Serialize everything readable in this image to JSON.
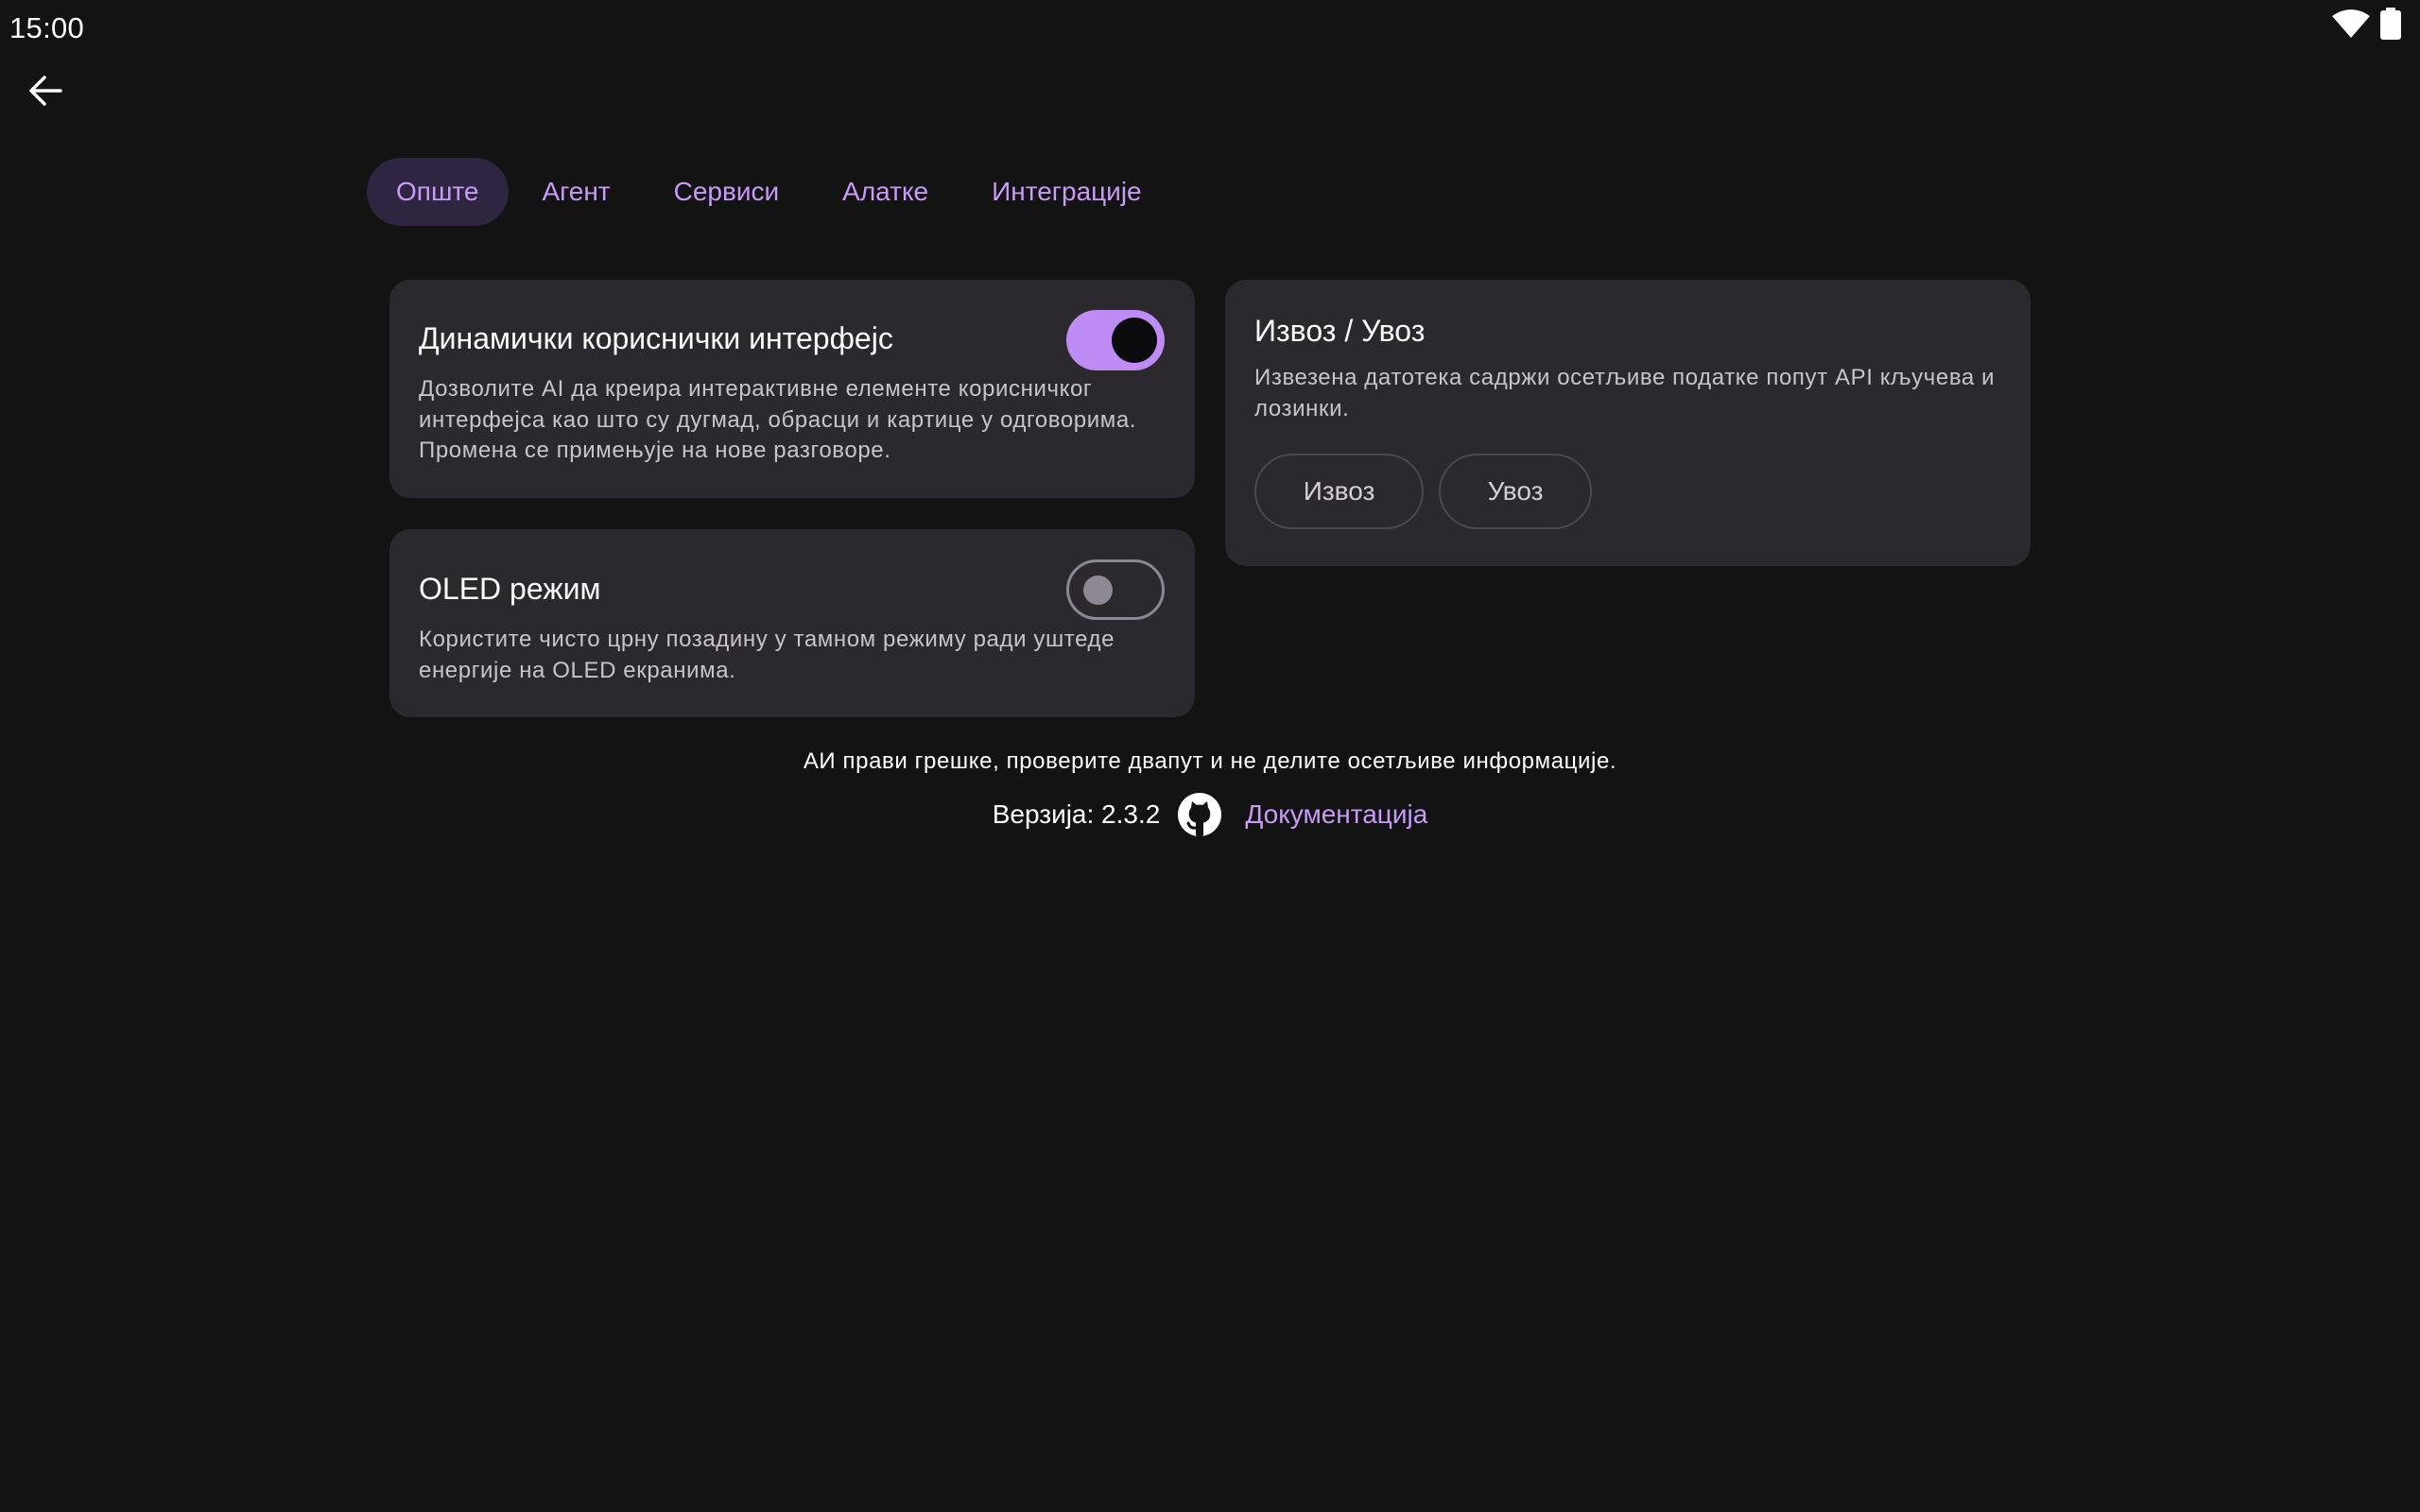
{
  "status_bar": {
    "time": "15:00",
    "icons": [
      "wifi-icon",
      "battery-icon"
    ]
  },
  "nav": {
    "back_icon": "arrow-left-icon"
  },
  "tabs": [
    {
      "label": "Опште",
      "active": true
    },
    {
      "label": "Агент",
      "active": false
    },
    {
      "label": "Сервиси",
      "active": false
    },
    {
      "label": "Алатке",
      "active": false
    },
    {
      "label": "Интеграције",
      "active": false
    }
  ],
  "settings": {
    "dynamic_ui": {
      "title": "Динамички кориснички интерфејс",
      "description": "Дозволите AI да креира интерактивне елементе корисничког интерфејса као што су дугмад, обрасци и картице у одговорима. Промена се примењује на нове разговоре.",
      "enabled": true
    },
    "oled": {
      "title": "OLED режим",
      "description": "Користите чисто црну позадину у тамном режиму ради уштеде енергије на OLED екранима.",
      "enabled": false
    },
    "export_import": {
      "title": "Извоз / Увоз",
      "description": "Извезена датотека садржи осетљиве податке попут API кључева и лозинки.",
      "export_label": "Извоз",
      "import_label": "Увоз"
    }
  },
  "footer": {
    "disclaimer": "АИ прави грешке, проверите двапут и не делите осетљиве информације.",
    "version": "Верзија: 2.3.2",
    "github_icon": "github-icon",
    "docs_label": "Документација"
  },
  "colors": {
    "background": "#131313",
    "card": "#2b292e",
    "accent": "#c79bf7",
    "switch_on": "#bf8cf6",
    "active_tab": "#2e2640"
  }
}
